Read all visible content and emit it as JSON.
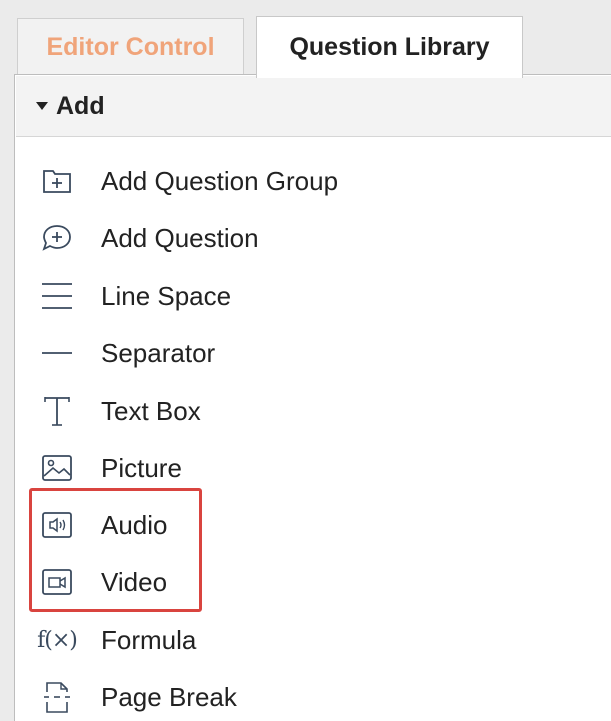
{
  "tabs": {
    "editor_control": "Editor Control",
    "question_library": "Question Library"
  },
  "section": {
    "title": "Add"
  },
  "items": [
    {
      "label": "Add Question Group",
      "icon": "folder-plus-icon"
    },
    {
      "label": "Add Question",
      "icon": "speech-bubble-plus-icon"
    },
    {
      "label": "Line Space",
      "icon": "line-space-icon"
    },
    {
      "label": "Separator",
      "icon": "separator-icon"
    },
    {
      "label": "Text Box",
      "icon": "text-box-icon"
    },
    {
      "label": "Picture",
      "icon": "picture-icon"
    },
    {
      "label": "Audio",
      "icon": "audio-icon"
    },
    {
      "label": "Video",
      "icon": "video-icon"
    },
    {
      "label": "Formula",
      "icon": "formula-icon",
      "glyph": "f(×)"
    },
    {
      "label": "Page Break",
      "icon": "page-break-icon"
    }
  ],
  "colors": {
    "editor_tab_text": "#f0a47a",
    "highlight_border": "#d9443f",
    "icon": "#3a4a5e"
  }
}
